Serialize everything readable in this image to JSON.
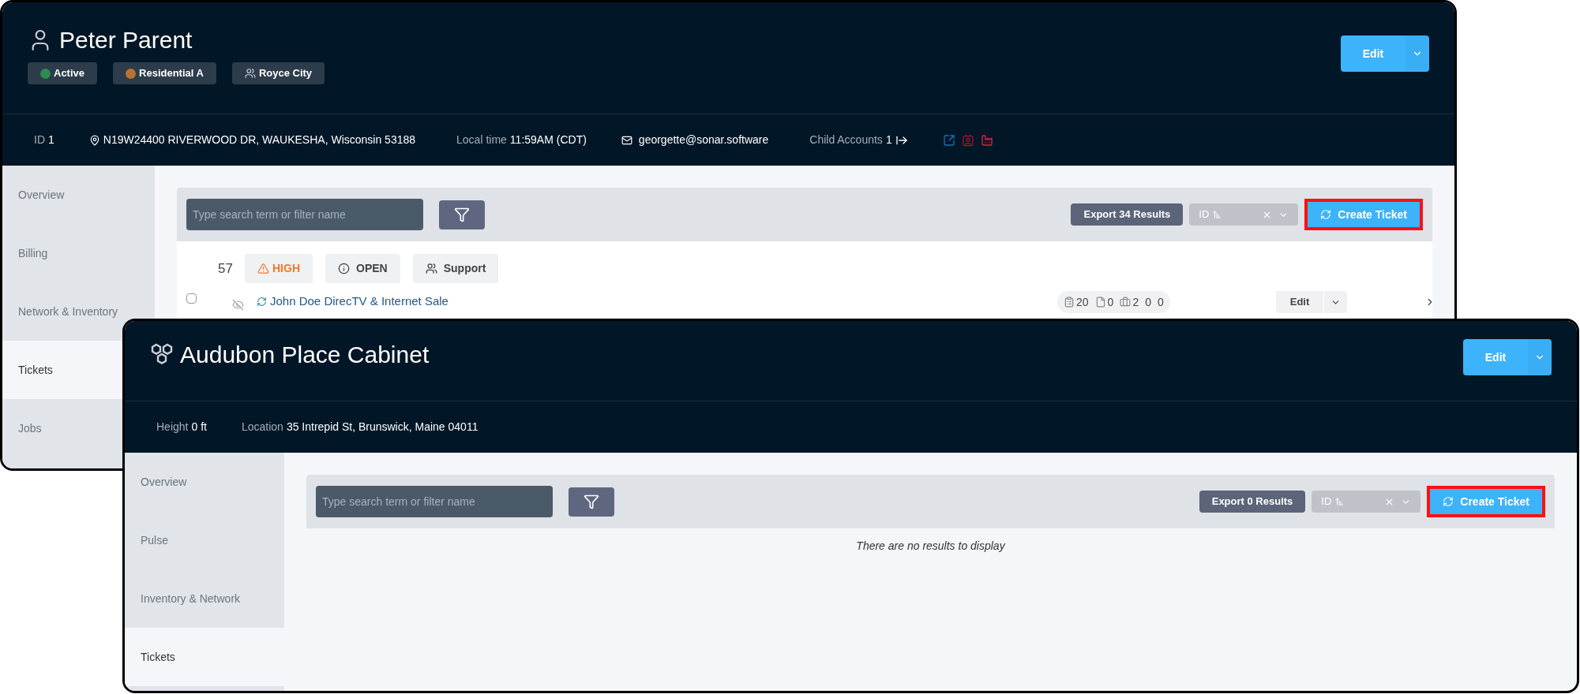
{
  "windows": [
    {
      "kind": "account",
      "title": "Peter Parent",
      "edit_button": {
        "label": "Edit"
      },
      "badges": [
        {
          "kind": "dot",
          "label": "Active",
          "color": "#2e8a4f"
        },
        {
          "kind": "dot",
          "label": "Residential A",
          "color": "#b87333"
        },
        {
          "kind": "group",
          "label": "Royce City"
        }
      ],
      "info": [
        {
          "kind": "field",
          "label": "ID",
          "value": "1"
        },
        {
          "kind": "location",
          "value": "N19W24400 RIVERWOOD DR, WAUKESHA, Wisconsin 53188"
        },
        {
          "kind": "field",
          "label": "Local time",
          "value": "11:59AM (CDT)"
        },
        {
          "kind": "email",
          "value": "georgette@sonar.software"
        },
        {
          "kind": "children",
          "label": "Child Accounts",
          "value": "1"
        }
      ],
      "sidebar": [
        {
          "label": "Overview",
          "selected": false
        },
        {
          "label": "Billing",
          "selected": false
        },
        {
          "label": "Network & Inventory",
          "selected": false
        },
        {
          "label": "Tickets",
          "selected": true
        },
        {
          "label": "Jobs",
          "selected": false
        }
      ],
      "toolbar": {
        "placeholder": "Type search term or filter name",
        "export": "Export 34 Results",
        "sort": "ID",
        "create": {
          "label": "Create Ticket",
          "highlighted": true
        }
      },
      "tickets": [
        {
          "number": "57",
          "priority": "HIGH",
          "status": "OPEN",
          "group": "Support",
          "title": "John Doe DirecTV & Internet Sale",
          "checked": false,
          "counts": [
            {
              "kind": "clipboard",
              "value": "20"
            },
            {
              "kind": "file",
              "value": "0"
            },
            {
              "kind": "briefcase",
              "value": "2"
            },
            {
              "kind": "plain",
              "value": "0"
            },
            {
              "kind": "plain",
              "value": "0"
            }
          ],
          "edit": "Edit"
        }
      ]
    },
    {
      "kind": "site",
      "title": "Audubon Place Cabinet",
      "edit_button": {
        "label": "Edit"
      },
      "info": [
        {
          "kind": "field",
          "label": "Height",
          "value": "0 ft"
        },
        {
          "kind": "field",
          "label": "Location",
          "value": "35 Intrepid St, Brunswick, Maine 04011"
        }
      ],
      "sidebar": [
        {
          "label": "Overview",
          "selected": false
        },
        {
          "label": "Pulse",
          "selected": false
        },
        {
          "label": "Inventory & Network",
          "selected": false
        },
        {
          "label": "Tickets",
          "selected": true
        }
      ],
      "toolbar": {
        "placeholder": "Type search term or filter name",
        "export": "Export 0 Results",
        "sort": "ID",
        "create": {
          "label": "Create Ticket",
          "highlighted": true
        }
      },
      "empty_message": "There are no results to display"
    }
  ]
}
